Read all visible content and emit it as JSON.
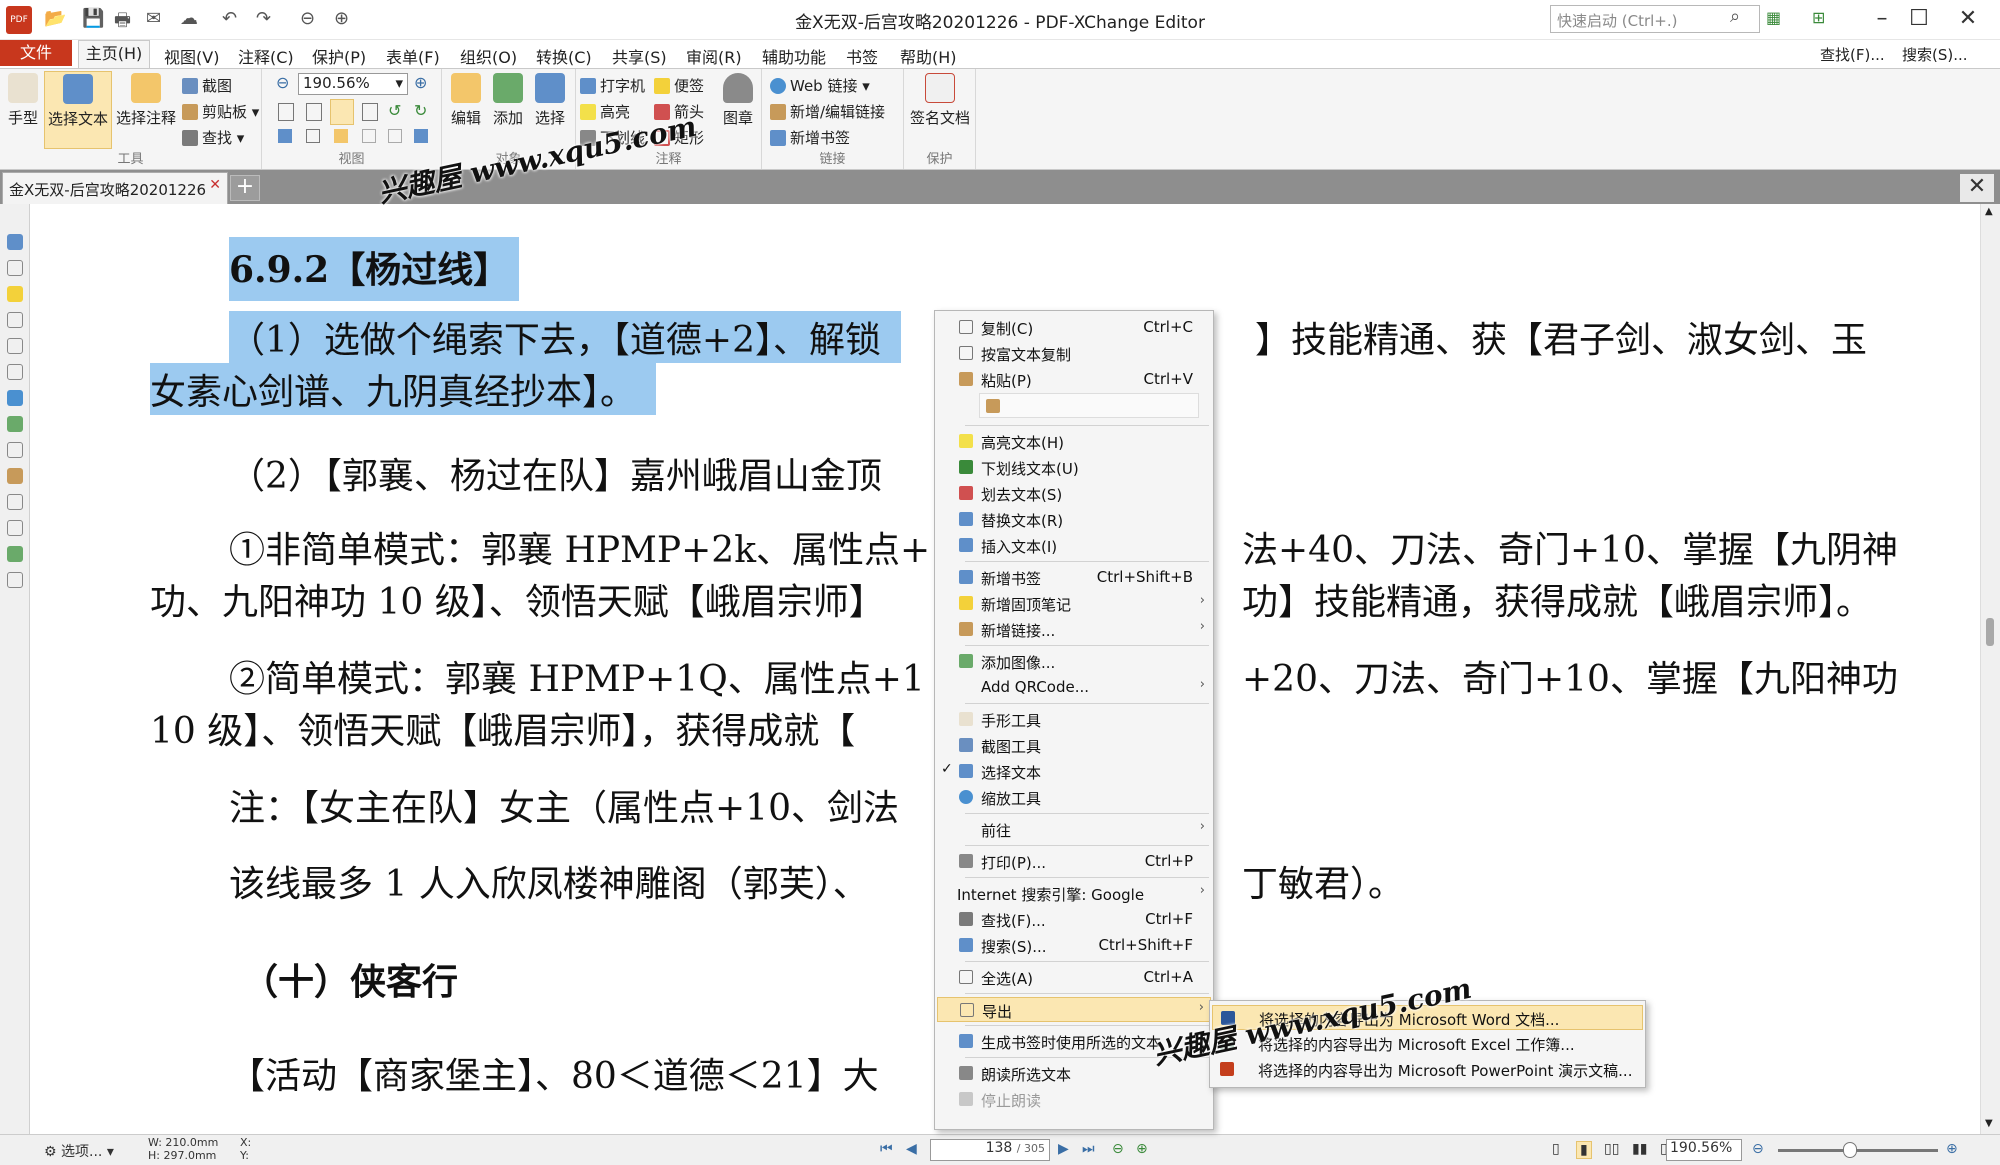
{
  "app": {
    "title": "金X无双-后宫攻略20201226 - PDF-XChange Editor",
    "quick_search_placeholder": "快速启动 (Ctrl+.)",
    "logo_text": "PDF"
  },
  "menubar": {
    "file": "文件",
    "items": [
      "主页(H)",
      "视图(V)",
      "注释(C)",
      "保护(P)",
      "表单(F)",
      "组织(O)",
      "转换(C)",
      "共享(S)",
      "审阅(R)",
      "辅助功能",
      "书签",
      "帮助(H)"
    ],
    "right": [
      "查找(F)...",
      "搜索(S)..."
    ]
  },
  "ribbon": {
    "tools": {
      "hand": "手型",
      "select_text": "选择文本",
      "select_annot": "选择注释",
      "label": "工具"
    },
    "clipboard": {
      "snapshot": "截图",
      "clipboard": "剪贴板",
      "find": "查找"
    },
    "view": {
      "zoom": "190.56%",
      "label": "视图"
    },
    "objects": {
      "edit": "编辑",
      "add": "添加",
      "select": "选择",
      "label": "对象"
    },
    "comment": {
      "typewriter": "打字机",
      "sticky": "便签",
      "highlight": "高亮",
      "arrow": "箭头",
      "underline": "下划线",
      "rect": "矩形",
      "stamp": "图章",
      "label": "注释"
    },
    "links": {
      "web": "Web 链接",
      "addedit": "新增/编辑链接",
      "bookmark": "新增书签",
      "label": "链接"
    },
    "protect": {
      "sign": "签名文档",
      "label": "保护"
    }
  },
  "tab": {
    "name": "金X无双-后宫攻略20201226"
  },
  "document": {
    "lines": [
      "6.9.2【杨过线】",
      "（1）选做个绳索下去，【道德+2】、解锁",
      "】技能精通、获【君子剑、淑女剑、玉",
      "女素心剑谱、九阴真经抄本】。",
      "（2）【郭襄、杨过在队】嘉州峨眉山金顶",
      "①非简单模式：郭襄 HPMP+2k、属性点+",
      "法+40、刀法、奇门+10、掌握【九阴神",
      "功、九阳神功 10 级】、领悟天赋【峨眉宗师】",
      "功】技能精通，获得成就【峨眉宗师】。",
      "②简单模式：郭襄 HPMP+1Q、属性点+1",
      "+20、刀法、奇门+10、掌握【九阳神功",
      "10 级】、领悟天赋【峨眉宗师】，获得成就【",
      "注：【女主在队】女主（属性点+10、剑法",
      "该线最多 1 人入欣凤楼神雕阁（郭芙）、",
      "丁敏君）。",
      "（十）侠客行",
      "【活动【商家堡主】、80＜道德＜21】大"
    ]
  },
  "context_menu": {
    "items": [
      {
        "label": "复制(C)",
        "shortcut": "Ctrl+C"
      },
      {
        "label": "按富文本复制",
        "shortcut": ""
      },
      {
        "label": "粘贴(P)",
        "shortcut": "Ctrl+V"
      },
      {
        "label": "高亮文本(H)",
        "shortcut": ""
      },
      {
        "label": "下划线文本(U)",
        "shortcut": ""
      },
      {
        "label": "划去文本(S)",
        "shortcut": ""
      },
      {
        "label": "替换文本(R)",
        "shortcut": ""
      },
      {
        "label": "插入文本(I)",
        "shortcut": ""
      },
      {
        "label": "新增书签",
        "shortcut": "Ctrl+Shift+B"
      },
      {
        "label": "新增固顶笔记",
        "shortcut": ""
      },
      {
        "label": "新增链接...",
        "shortcut": ""
      },
      {
        "label": "添加图像...",
        "shortcut": ""
      },
      {
        "label": "Add QRCode...",
        "shortcut": ""
      },
      {
        "label": "手形工具",
        "shortcut": ""
      },
      {
        "label": "截图工具",
        "shortcut": ""
      },
      {
        "label": "选择文本",
        "shortcut": ""
      },
      {
        "label": "缩放工具",
        "shortcut": ""
      },
      {
        "label": "前往",
        "shortcut": ""
      },
      {
        "label": "打印(P)...",
        "shortcut": "Ctrl+P"
      },
      {
        "label": "Internet 搜索引擎: Google",
        "shortcut": ""
      },
      {
        "label": "查找(F)...",
        "shortcut": "Ctrl+F"
      },
      {
        "label": "搜索(S)...",
        "shortcut": "Ctrl+Shift+F"
      },
      {
        "label": "全选(A)",
        "shortcut": "Ctrl+A"
      },
      {
        "label": "导出",
        "shortcut": ""
      },
      {
        "label": "生成书签时使用所选的文本",
        "shortcut": ""
      },
      {
        "label": "朗读所选文本",
        "shortcut": ""
      },
      {
        "label": "停止朗读",
        "shortcut": ""
      }
    ]
  },
  "submenu": {
    "items": [
      "将选择的内容导出为 Microsoft Word 文档...",
      "将选择的内容导出为 Microsoft Excel 工作簿...",
      "将选择的内容导出为 Microsoft PowerPoint 演示文稿..."
    ]
  },
  "statusbar": {
    "options": "选项...",
    "width": "W: 210.0mm",
    "height": "H: 297.0mm",
    "x": "X:",
    "y": "Y:",
    "page": "138",
    "total": "/ 305",
    "zoom": "190.56%"
  },
  "watermark": {
    "text": "兴趣屋 www.xqu5.com"
  },
  "colors": {
    "file_tab": "#c8371d",
    "selection": "#9ccaf0",
    "menu_hover": "#fbe7b2"
  }
}
